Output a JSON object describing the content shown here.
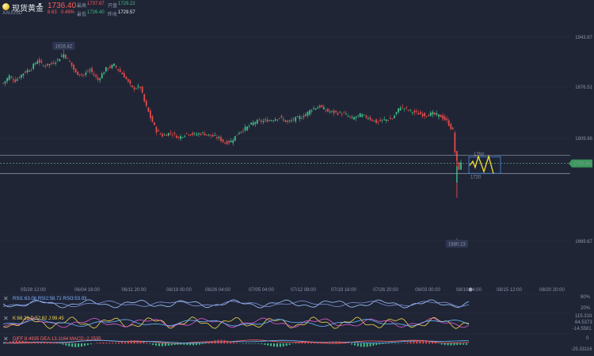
{
  "header": {
    "symbol_name": "现货黄金",
    "symbol_code": "XAUUSD",
    "last_price": "1736.40",
    "change": "8.63",
    "change_pct": "0.49%",
    "high_label": "最高",
    "high": "1737.67",
    "open_label": "开盘",
    "open": "1729.22",
    "low_label": "最低",
    "low": "1726.40",
    "prev_close_label": "昨收",
    "prev_close": "1729.57"
  },
  "colors": {
    "up": "#3fbf8a",
    "down": "#e54b4b",
    "background": "#1f2535",
    "price_tag": "#3a9a5a"
  },
  "chart_data": {
    "type": "candlestick",
    "x_ticks": [
      "05/28 12:00",
      "06/04 16:00",
      "06/11 20:00",
      "06/19 00:00",
      "06/26 04:00",
      "07/05 04:00",
      "07/12 08:00",
      "07/19 16:00",
      "07/26 20:00",
      "08/03 00:00",
      "08/10 04:00",
      "08/15 12:00",
      "08/20 20:00"
    ],
    "y_ticks": [
      "1943.87",
      "1876.51",
      "1809.86",
      "1669.67"
    ],
    "current_price_tag": "1735.40",
    "max_label": "1916.42",
    "min_label": "1680.23",
    "annotation_upper": "1750",
    "annotation_lower": "1720",
    "anchors": [
      [
        0,
        1868
      ],
      [
        3,
        1880
      ],
      [
        6,
        1872
      ],
      [
        10,
        1885
      ],
      [
        14,
        1893
      ],
      [
        17,
        1906
      ],
      [
        20,
        1897
      ],
      [
        24,
        1900
      ],
      [
        27,
        1907
      ],
      [
        30,
        1916
      ],
      [
        33,
        1903
      ],
      [
        36,
        1885
      ],
      [
        40,
        1882
      ],
      [
        43,
        1890
      ],
      [
        47,
        1874
      ],
      [
        51,
        1892
      ],
      [
        55,
        1898
      ],
      [
        60,
        1880
      ],
      [
        64,
        1860
      ],
      [
        68,
        1862
      ],
      [
        70,
        1838
      ],
      [
        73,
        1812
      ],
      [
        76,
        1790
      ],
      [
        79,
        1782
      ],
      [
        83,
        1787
      ],
      [
        87,
        1779
      ],
      [
        91,
        1786
      ],
      [
        95,
        1784
      ],
      [
        99,
        1786
      ],
      [
        103,
        1782
      ],
      [
        107,
        1778
      ],
      [
        110,
        1770
      ],
      [
        113,
        1773
      ],
      [
        117,
        1788
      ],
      [
        121,
        1796
      ],
      [
        125,
        1805
      ],
      [
        129,
        1806
      ],
      [
        133,
        1808
      ],
      [
        137,
        1812
      ],
      [
        141,
        1804
      ],
      [
        145,
        1810
      ],
      [
        149,
        1814
      ],
      [
        153,
        1826
      ],
      [
        157,
        1830
      ],
      [
        161,
        1822
      ],
      [
        165,
        1820
      ],
      [
        169,
        1818
      ],
      [
        173,
        1810
      ],
      [
        177,
        1816
      ],
      [
        181,
        1812
      ],
      [
        185,
        1804
      ],
      [
        189,
        1808
      ],
      [
        193,
        1810
      ],
      [
        197,
        1830
      ],
      [
        201,
        1824
      ],
      [
        205,
        1819
      ],
      [
        209,
        1816
      ],
      [
        213,
        1818
      ],
      [
        217,
        1814
      ],
      [
        220,
        1806
      ],
      [
        223,
        1790
      ],
      [
        224,
        1755
      ],
      [
        225,
        1738
      ],
      [
        226,
        1728
      ],
      [
        227,
        1736
      ]
    ]
  },
  "indicators": {
    "rsi": {
      "label": "RSI",
      "values": "RSI1:63.08 RSI2:58.71 RSI3:53.93",
      "scale_top": "80%",
      "scale_bottom": "20%"
    },
    "kdj": {
      "label": "KDJ",
      "values": "K:68.23 D:52.62 J:99.45",
      "scale_top": "115.319",
      "scale_mid": "64.5373",
      "scale_bottom": "-14.5581"
    },
    "macd": {
      "values": "DIFF:8.4935 DEA:13.1164 MACD:-2.2535",
      "scale_top": "0",
      "scale_bottom": "-25.33116"
    }
  }
}
